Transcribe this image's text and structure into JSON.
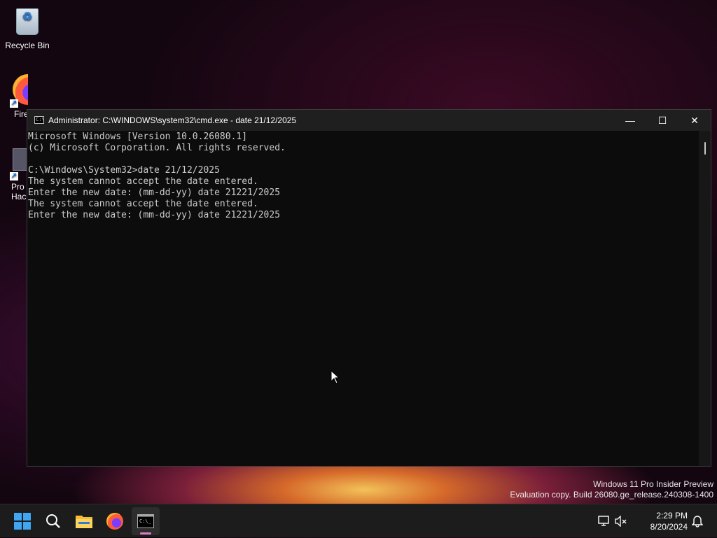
{
  "desktop": {
    "icons": [
      {
        "label": "Recycle Bin"
      },
      {
        "label": "Fire"
      },
      {
        "label": "Pro\nHac"
      }
    ]
  },
  "cmd": {
    "title": "Administrator: C:\\WINDOWS\\system32\\cmd.exe - date  21/12/2025",
    "icon_text": "C:\\",
    "minimize_glyph": "—",
    "maximize_glyph": "☐",
    "close_glyph": "✕",
    "lines": [
      "Microsoft Windows [Version 10.0.26080.1]",
      "(c) Microsoft Corporation. All rights reserved.",
      "",
      "C:\\Windows\\System32>date 21/12/2025",
      "The system cannot accept the date entered.",
      "Enter the new date: (mm-dd-yy) date 21221/2025",
      "The system cannot accept the date entered.",
      "Enter the new date: (mm-dd-yy) date 21221/2025"
    ]
  },
  "watermark": {
    "line1": "Windows 11 Pro Insider Preview",
    "line2": "Evaluation copy. Build 26080.ge_release.240308-1400"
  },
  "taskbar": {
    "items": [
      "start-icon",
      "search-icon",
      "file-explorer-icon",
      "firefox-icon",
      "terminal-icon"
    ],
    "time": "2:29 PM",
    "date": "8/20/2024"
  },
  "colors": {
    "terminal_bg": "#0c0c0c",
    "terminal_fg": "#cccccc",
    "titlebar_bg": "#1f1f1f",
    "taskbar_bg": "#1c1c1c",
    "active_indicator": "#e07bc1"
  }
}
